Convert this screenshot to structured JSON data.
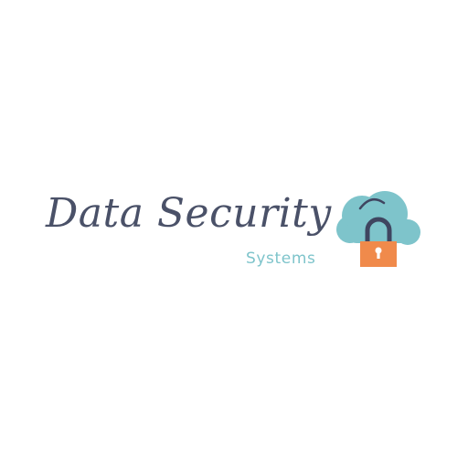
{
  "logo": {
    "name": "Data Security",
    "subtitle": "Systems",
    "icon": "cloud-lock-icon",
    "colors": {
      "name": "#4a5168",
      "subtitle": "#7ec4cb",
      "cloud": "#7ec4cb",
      "shackle": "#3f4560",
      "lock_body": "#f08a4b",
      "keyhole": "#ffffff"
    }
  }
}
